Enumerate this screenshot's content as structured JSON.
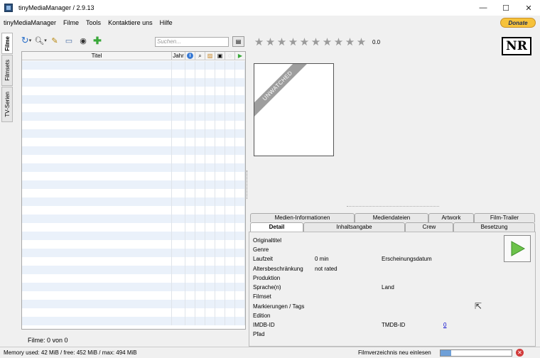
{
  "window": {
    "title": "tinyMediaManager / 2.9.13",
    "controls": [
      "—",
      "☐",
      "✕"
    ]
  },
  "menu": {
    "items": [
      "tinyMediaManager",
      "Filme",
      "Tools",
      "Kontaktiere uns",
      "Hilfe"
    ],
    "donate": "Donate"
  },
  "sidebar": {
    "tabs": [
      "Filme",
      "Filmsets",
      "TV-Serien"
    ]
  },
  "search": {
    "placeholder": "Suchen..."
  },
  "table": {
    "columns": [
      "Titel",
      "Jahr"
    ],
    "icon_columns": [
      "info-icon",
      "search-icon",
      "image-icon",
      "film-icon",
      "subtitle-icon",
      "play-icon"
    ],
    "row_count": 0
  },
  "status_left": "Filme:  0  von  0",
  "rating": {
    "stars": 10,
    "value": "0.0"
  },
  "logo": "NR",
  "poster": {
    "ribbon": "UNWATCHED"
  },
  "tabs": {
    "row1": [
      "Medien-Informationen",
      "Mediendateien",
      "Artwork",
      "Film-Trailer"
    ],
    "row2": [
      "Detail",
      "Inhaltsangabe",
      "Crew",
      "Besetzung"
    ]
  },
  "detail": {
    "originaltitel": "Originaltitel",
    "genre": "Genre",
    "laufzeit_label": "Laufzeit",
    "laufzeit_value": "0  min",
    "erscheinungsdatum": "Erscheinungsdatum",
    "alters_label": "Altersbeschränkung",
    "alters_value": "not rated",
    "produktion": "Produktion",
    "sprache": "Sprache(n)",
    "land": "Land",
    "filmset": "Filmset",
    "tags": "Markierungen / Tags",
    "edition": "Edition",
    "imdb": "IMDB-ID",
    "tmdb_label": "TMDB-ID",
    "tmdb_value": "0",
    "pfad": "Pfad"
  },
  "statusbar": {
    "memory": "Memory used: 42 MiB  /  free: 452 MiB  /  max: 494 MiB",
    "task": "Filmverzeichnis neu einlesen",
    "progress": 0.15
  }
}
